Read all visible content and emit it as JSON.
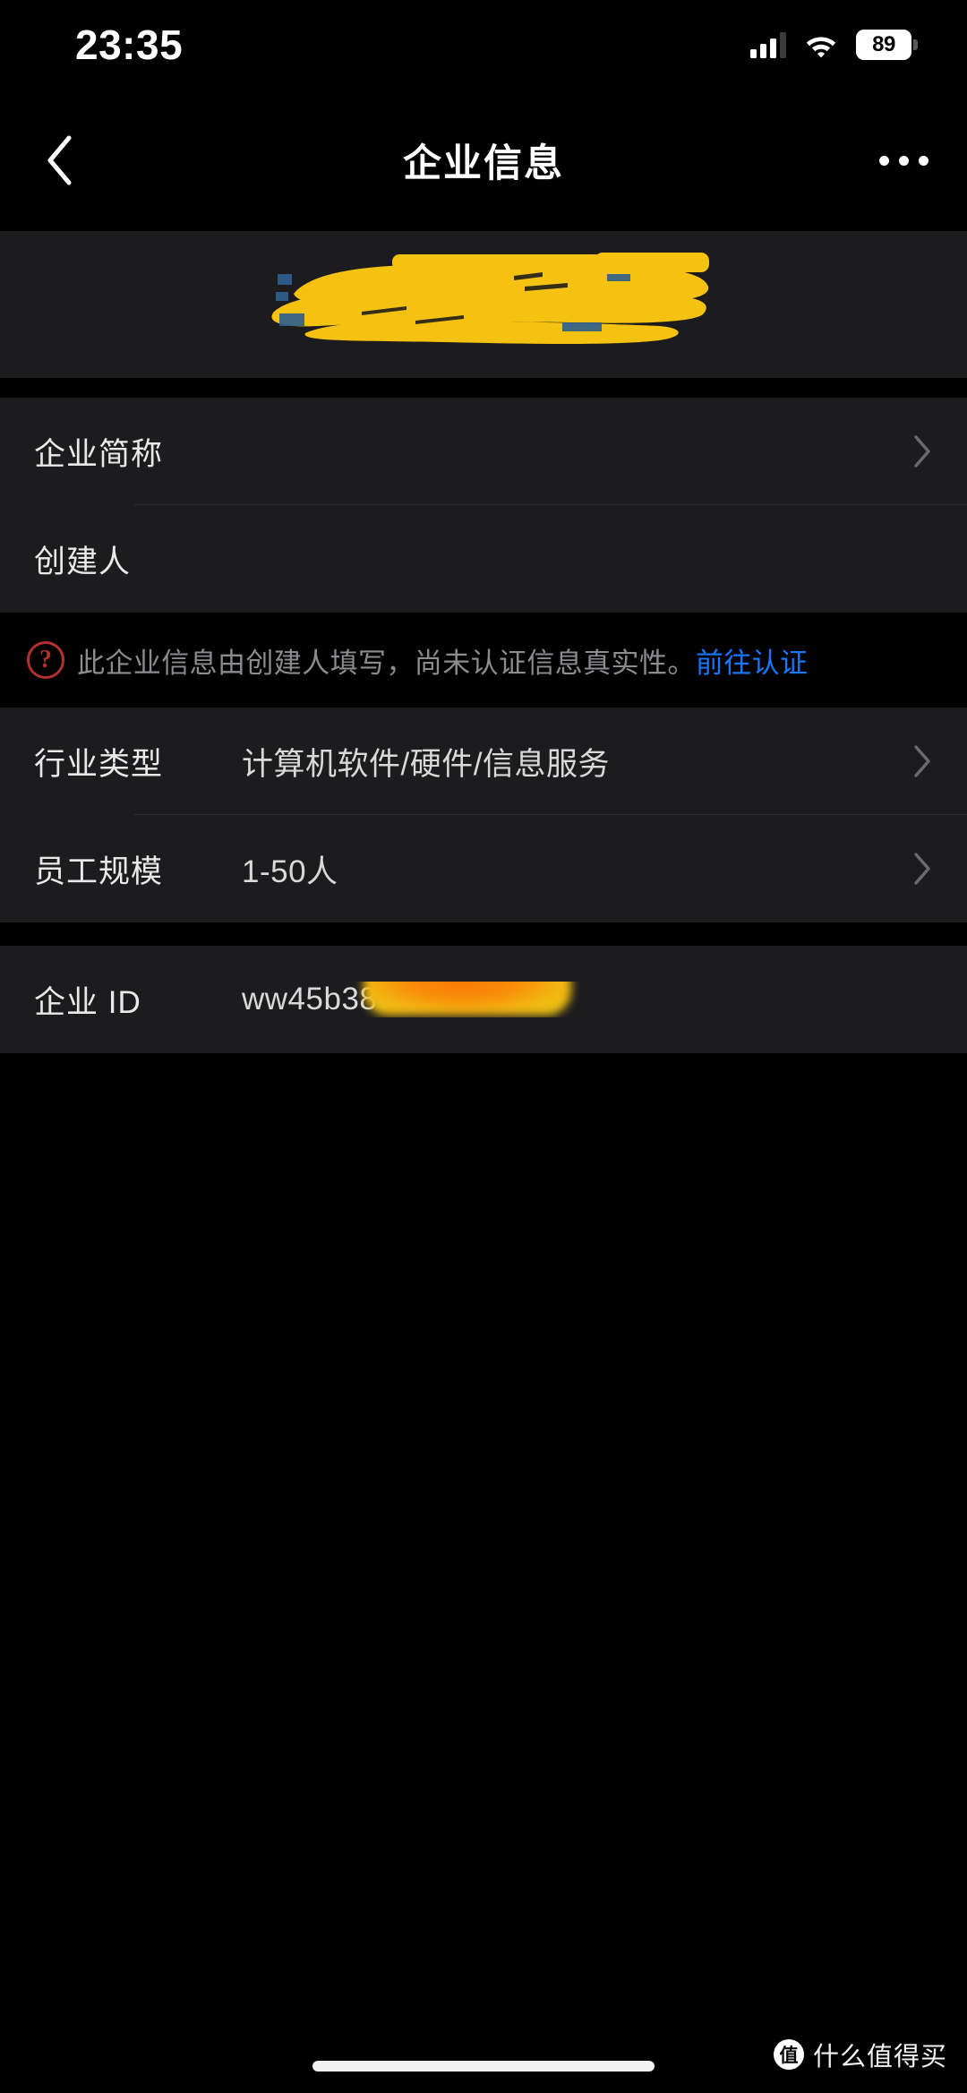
{
  "status_bar": {
    "time": "23:35",
    "battery_percent": "89",
    "signal_icon": "cellular-signal-icon",
    "wifi_icon": "wifi-icon",
    "battery_icon": "battery-icon"
  },
  "nav": {
    "title": "企业信息",
    "back_icon": "chevron-left-icon",
    "more_icon": "more-dots-icon"
  },
  "hero": {
    "company_name": "",
    "redaction_color": "#f5c211",
    "redacted": "true"
  },
  "rows_primary": [
    {
      "label": "企业简称",
      "value": "",
      "redacted": "true",
      "chevron": "true"
    },
    {
      "label": "创建人",
      "value": "",
      "redacted": "true",
      "chevron": "false"
    }
  ],
  "notice": {
    "icon": "question-circle-icon",
    "icon_glyph": "?",
    "text": "此企业信息由创建人填写，尚未认证信息真实性。",
    "link_label": "前往认证",
    "link_color": "#1677ff",
    "icon_color": "#b33030"
  },
  "rows_secondary": [
    {
      "label": "行业类型",
      "value": "计算机软件/硬件/信息服务",
      "chevron": "true"
    },
    {
      "label": "员工规模",
      "value": "1-50人",
      "chevron": "true"
    }
  ],
  "rows_id": [
    {
      "label": "企业 ID",
      "value": "ww45b38",
      "redacted": "true",
      "chevron": "false"
    }
  ],
  "watermark": {
    "logo_glyph": "值",
    "text": "什么值得买"
  },
  "colors": {
    "page_background": "#000000",
    "card_background": "#1c1c1e",
    "label_text": "#e9e9ea",
    "value_text": "#d9d9da",
    "notice_text": "#8c8c90",
    "separator": "#2e2e30",
    "accent_link": "#1677ff",
    "redaction_yellow": "#f5c211",
    "redaction_orange": "#f58a07"
  }
}
